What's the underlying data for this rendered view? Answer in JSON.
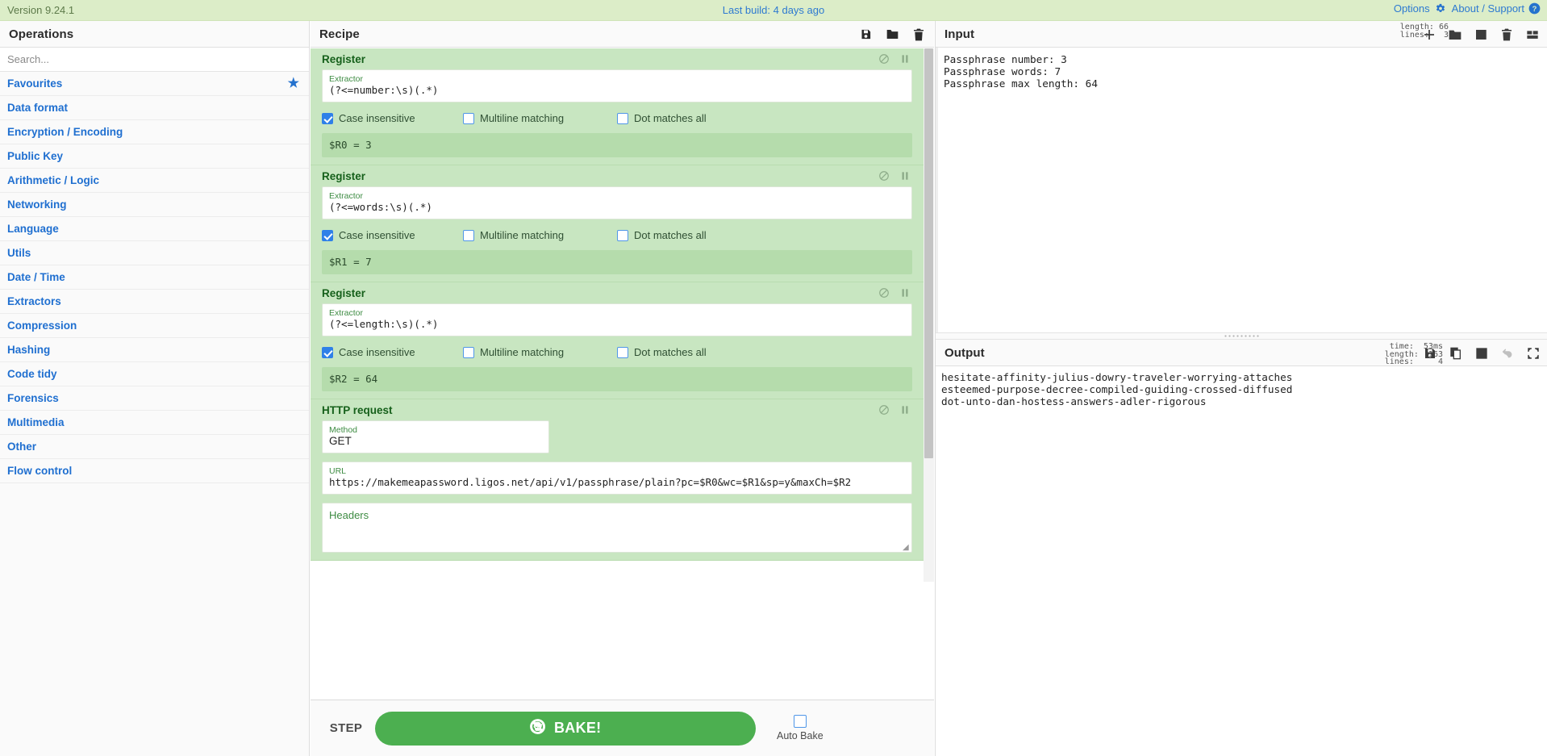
{
  "banner": {
    "version": "Version 9.24.1",
    "last_build": "Last build: 4 days ago",
    "options": "Options",
    "about": "About / Support"
  },
  "operations": {
    "title": "Operations",
    "search_placeholder": "Search...",
    "categories": [
      {
        "label": "Favourites",
        "starred": true
      },
      {
        "label": "Data format",
        "starred": false
      },
      {
        "label": "Encryption / Encoding",
        "starred": false
      },
      {
        "label": "Public Key",
        "starred": false
      },
      {
        "label": "Arithmetic / Logic",
        "starred": false
      },
      {
        "label": "Networking",
        "starred": false
      },
      {
        "label": "Language",
        "starred": false
      },
      {
        "label": "Utils",
        "starred": false
      },
      {
        "label": "Date / Time",
        "starred": false
      },
      {
        "label": "Extractors",
        "starred": false
      },
      {
        "label": "Compression",
        "starred": false
      },
      {
        "label": "Hashing",
        "starred": false
      },
      {
        "label": "Code tidy",
        "starred": false
      },
      {
        "label": "Forensics",
        "starred": false
      },
      {
        "label": "Multimedia",
        "starred": false
      },
      {
        "label": "Other",
        "starred": false
      },
      {
        "label": "Flow control",
        "starred": false
      }
    ]
  },
  "recipe": {
    "title": "Recipe",
    "operations": [
      {
        "name": "Register",
        "arg_label": "Extractor",
        "arg_value": "(?<=number:\\s)(.*)",
        "checkboxes": [
          {
            "label": "Case insensitive",
            "checked": true
          },
          {
            "label": "Multiline matching",
            "checked": false
          },
          {
            "label": "Dot matches all",
            "checked": false
          }
        ],
        "register_output": "$R0 = 3"
      },
      {
        "name": "Register",
        "arg_label": "Extractor",
        "arg_value": "(?<=words:\\s)(.*)",
        "checkboxes": [
          {
            "label": "Case insensitive",
            "checked": true
          },
          {
            "label": "Multiline matching",
            "checked": false
          },
          {
            "label": "Dot matches all",
            "checked": false
          }
        ],
        "register_output": "$R1 = 7"
      },
      {
        "name": "Register",
        "arg_label": "Extractor",
        "arg_value": "(?<=length:\\s)(.*)",
        "checkboxes": [
          {
            "label": "Case insensitive",
            "checked": true
          },
          {
            "label": "Multiline matching",
            "checked": false
          },
          {
            "label": "Dot matches all",
            "checked": false
          }
        ],
        "register_output": "$R2 = 64"
      }
    ],
    "http_request": {
      "name": "HTTP request",
      "method_label": "Method",
      "method_value": "GET",
      "url_label": "URL",
      "url_value": "https://makemeapassword.ligos.net/api/v1/passphrase/plain?pc=$R0&wc=$R1&sp=y&maxCh=$R2",
      "headers_label": "Headers"
    },
    "controls": {
      "step": "STEP",
      "bake": "BAKE!",
      "auto_bake": "Auto Bake",
      "auto_bake_checked": false
    }
  },
  "input": {
    "title": "Input",
    "meta_length": "length: 66",
    "meta_lines": "lines:   3",
    "text": "Passphrase number: 3\nPassphrase words: 7\nPassphrase max length: 64"
  },
  "output": {
    "title": "Output",
    "meta_time": "time:  53ms",
    "meta_length": "length:  163",
    "meta_lines": "lines:     4",
    "text": "hesitate-affinity-julius-dowry-traveler-worrying-attaches\nesteemed-purpose-decree-compiled-guiding-crossed-diffused\ndot-unto-dan-hostess-answers-adler-rigorous"
  },
  "colors": {
    "banner_bg": "#dcedc8",
    "link_blue": "#2e7ad1",
    "operation_green": "#c8e6c1",
    "bake_green": "#4caf50",
    "register_out_green": "#b5dcac"
  }
}
